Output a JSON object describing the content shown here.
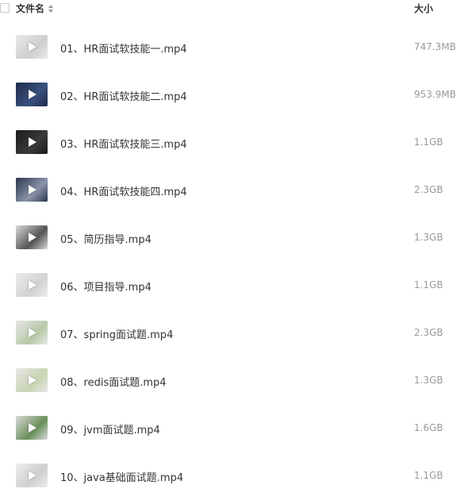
{
  "header": {
    "name_label": "文件名",
    "size_label": "大小"
  },
  "files": [
    {
      "name": "01、HR面试软技能一.mp4",
      "size": "747.3MB",
      "thumb_color": "#e9e9e9",
      "thumb_accent": "#cfcfcf"
    },
    {
      "name": "02、HR面试软技能二.mp4",
      "size": "953.9MB",
      "thumb_color": "#1e2a4a",
      "thumb_accent": "#39507f"
    },
    {
      "name": "03、HR面试软技能三.mp4",
      "size": "1.1GB",
      "thumb_color": "#1a1a1a",
      "thumb_accent": "#3a3a3a"
    },
    {
      "name": "04、HR面试软技能四.mp4",
      "size": "2.3GB",
      "thumb_color": "#2a3550",
      "thumb_accent": "#8a93a8"
    },
    {
      "name": "05、简历指导.mp4",
      "size": "1.3GB",
      "thumb_color": "#d8d8d8",
      "thumb_accent": "#555555"
    },
    {
      "name": "06、项目指导.mp4",
      "size": "1.1GB",
      "thumb_color": "#ececec",
      "thumb_accent": "#d2d2d2"
    },
    {
      "name": "07、spring面试题.mp4",
      "size": "2.3GB",
      "thumb_color": "#e6e6e6",
      "thumb_accent": "#b8c9a8"
    },
    {
      "name": "08、redis面试题.mp4",
      "size": "1.3GB",
      "thumb_color": "#e8e8e8",
      "thumb_accent": "#c9d3b0"
    },
    {
      "name": "09、jvm面试题.mp4",
      "size": "1.6GB",
      "thumb_color": "#d9d9d9",
      "thumb_accent": "#6b8f5a"
    },
    {
      "name": "10、java基础面试题.mp4",
      "size": "1.1GB",
      "thumb_color": "#ededed",
      "thumb_accent": "#cfcfcf"
    }
  ]
}
